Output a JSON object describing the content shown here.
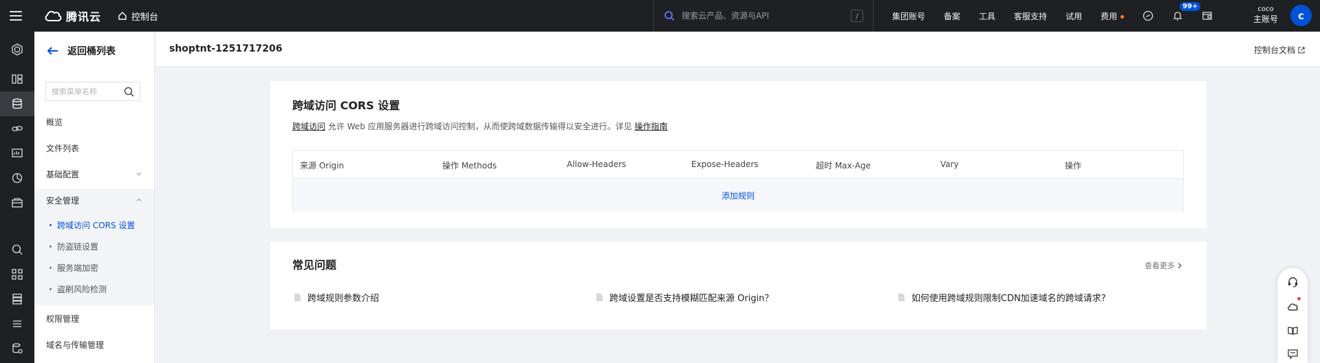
{
  "topbar": {
    "brand": "腾讯云",
    "console_label": "控制台",
    "search_placeholder": "搜索云产品、资源与API",
    "search_shortcut": "/",
    "nav": [
      "集团账号",
      "备案",
      "工具",
      "客服支持",
      "试用",
      "费用"
    ],
    "notification_count": "99+",
    "account_name": "coco",
    "account_type": "主账号",
    "avatar_letter": "c"
  },
  "rail": {
    "icons": [
      "cube-icon",
      "dashboard-icon",
      "storage-icon",
      "link-icon",
      "monitor-icon",
      "chart-icon",
      "box-icon",
      "search-plus-icon",
      "grid-icon",
      "database-icon",
      "list-icon",
      "database-settings-icon"
    ],
    "active_index": 2
  },
  "sidebar": {
    "back_label": "返回桶列表",
    "search_placeholder": "搜索菜单名称",
    "menu": {
      "overview": "概览",
      "files": "文件列表",
      "basic": "基础配置",
      "security": "安全管理",
      "permission": "权限管理",
      "domain": "域名与传输管理"
    },
    "security_sub": [
      "跨域访问 CORS 设置",
      "防盗链设置",
      "服务端加密",
      "盗刷风险检测"
    ],
    "active_sub_index": 0
  },
  "header": {
    "bucket": "shoptnt-1251717206",
    "doc_link": "控制台文档"
  },
  "cors": {
    "title": "跨域访问 CORS 设置",
    "desc_link": "跨域访问",
    "desc_text": " 允许 Web 应用服务器进行跨域访问控制，从而使跨域数据传输得以安全进行。详见 ",
    "guide_link": "操作指南",
    "columns": [
      "来源 Origin",
      "操作 Methods",
      "Allow-Headers",
      "Expose-Headers",
      "超时 Max-Age",
      "Vary",
      "操作"
    ],
    "add_rule": "添加规则"
  },
  "faq": {
    "title": "常见问题",
    "more": "查看更多",
    "items": [
      "跨域规则参数介绍",
      "跨域设置是否支持模糊匹配来源 Origin？",
      "如何使用跨域规则限制CDN加速域名的跨域请求?"
    ]
  },
  "colors": {
    "brand_blue": "#0052d9",
    "topbar_bg": "#1f2024",
    "notice_orange": "#ff7b29"
  }
}
